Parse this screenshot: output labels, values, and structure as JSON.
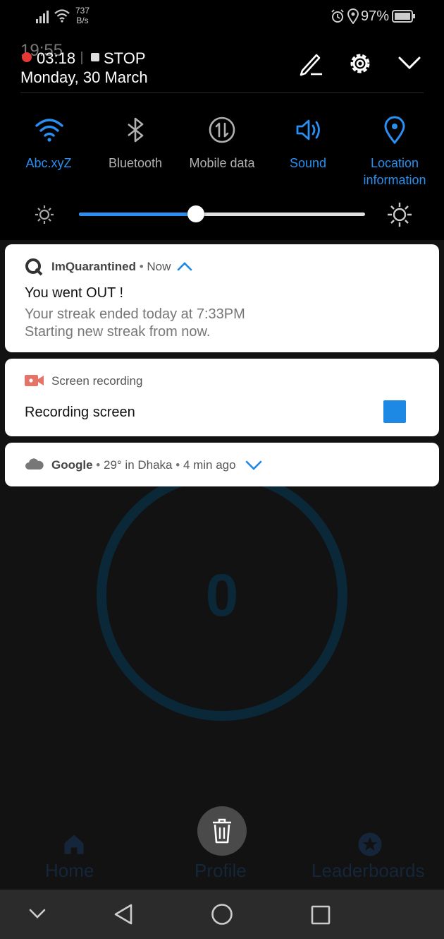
{
  "status_bar": {
    "network_speed_value": "737",
    "network_speed_unit": "B/s",
    "battery": "97%"
  },
  "header": {
    "clock_overlap": "19:55",
    "recording_time": "03:18",
    "stop_label": "STOP",
    "date": "Monday, 30 March"
  },
  "quick_settings": [
    {
      "label": "Abc.xyZ",
      "icon": "wifi-icon",
      "active": true
    },
    {
      "label": "Bluetooth",
      "icon": "bluetooth-icon",
      "active": false
    },
    {
      "label": "Mobile data",
      "icon": "mobile-data-icon",
      "active": false
    },
    {
      "label": "Sound",
      "icon": "sound-icon",
      "active": true
    },
    {
      "label": "Location information",
      "icon": "location-icon",
      "active": true
    }
  ],
  "brightness": {
    "level": 0.41
  },
  "notifications": [
    {
      "app": "ImQuarantined",
      "time": "Now",
      "title": "You went OUT !",
      "line1": "Your streak ended today at 7:33PM",
      "line2": "Starting new streak from now."
    },
    {
      "app": "Screen recording",
      "title": "Recording screen"
    },
    {
      "app": "Google",
      "detail": "29° in Dhaka",
      "time": "4 min ago"
    }
  ],
  "background_app": {
    "counter": "0",
    "nav": [
      "Home",
      "Profile",
      "Leaderboards"
    ]
  },
  "colors": {
    "accent": "#2a8ff0",
    "record_red": "#e53935",
    "stop_blue": "#1e88e5"
  }
}
